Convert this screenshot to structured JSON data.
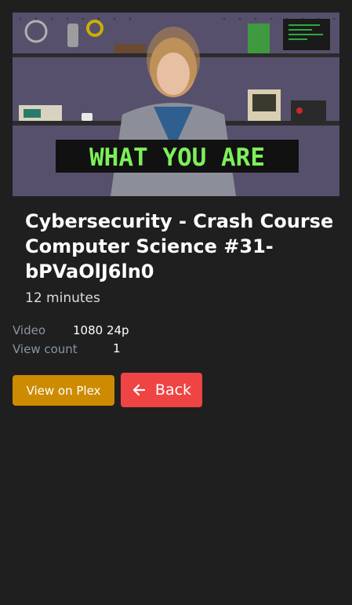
{
  "media": {
    "title": "Cybersecurity - Crash Course Computer Science #31-bPVaOlJ6ln0",
    "duration": "12 minutes",
    "thumbnail_caption": "WHAT YOU ARE"
  },
  "details": {
    "video_label": "Video",
    "video_value": "1080 24p",
    "view_count_label": "View count",
    "view_count_value": "1"
  },
  "actions": {
    "plex_label": "View on Plex",
    "back_label": "Back",
    "back_icon": "arrow-left-icon"
  },
  "colors": {
    "background": "#1f1f1f",
    "plex_button": "#cc8b00",
    "back_button": "#ef4444",
    "muted_label": "#8a94a2"
  }
}
